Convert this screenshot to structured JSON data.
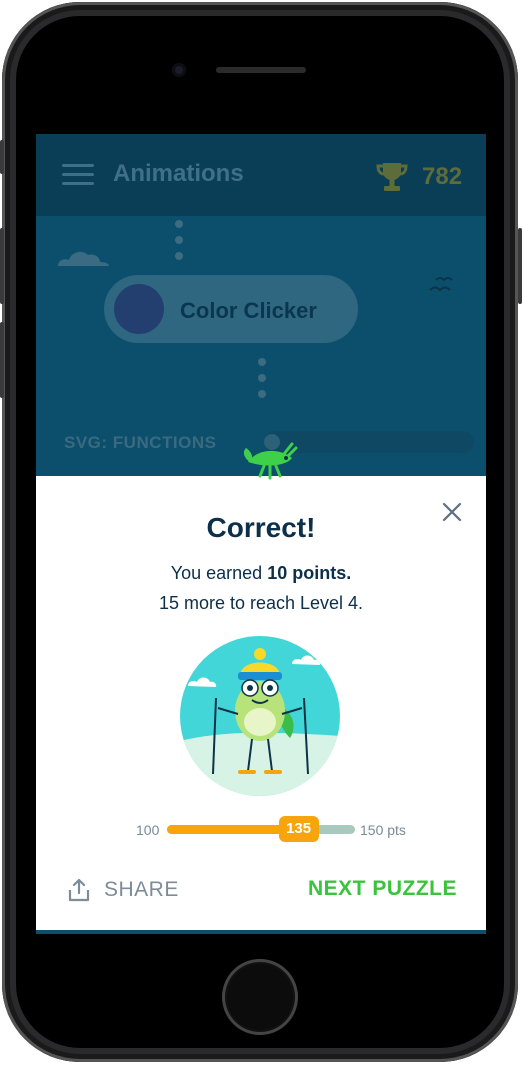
{
  "header": {
    "title": "Animations",
    "score": "782"
  },
  "lesson": {
    "label": "Color Clicker"
  },
  "section": {
    "label": "SVG: FUNCTIONS"
  },
  "modal": {
    "title": "Correct!",
    "earned_prefix": "You earned",
    "earned_points": "10 points.",
    "level_text": "15 more to reach Level 4.",
    "progress": {
      "min_label": "100",
      "max_label": "150 pts",
      "current_label": "135",
      "min": 100,
      "max": 150,
      "value": 135
    },
    "share_label": "SHARE",
    "next_label": "NEXT PUZZLE"
  },
  "colors": {
    "accent_green": "#3ac43c",
    "progress_orange": "#f7a50c",
    "text_dark": "#0c2f4a"
  }
}
